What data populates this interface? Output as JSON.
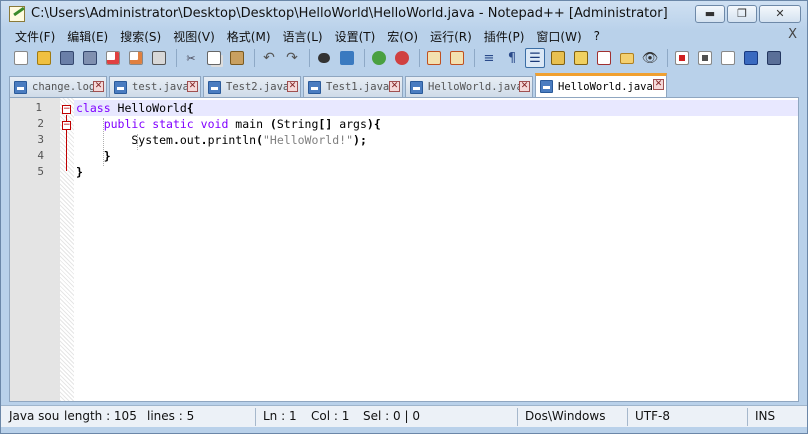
{
  "window": {
    "title": "C:\\Users\\Administrator\\Desktop\\Desktop\\HelloWorld\\HelloWorld.java - Notepad++ [Administrator]",
    "minimize": "▬",
    "restore": "❐",
    "close": "✕"
  },
  "menu": {
    "items": [
      "文件(F)",
      "编辑(E)",
      "搜索(S)",
      "视图(V)",
      "格式(M)",
      "语言(L)",
      "设置(T)",
      "宏(O)",
      "运行(R)",
      "插件(P)",
      "窗口(W)",
      "?"
    ],
    "close": "X"
  },
  "toolbar": {
    "icons": [
      "new-file-icon",
      "open-file-icon",
      "save-icon",
      "save-all-icon",
      "close-icon",
      "close-all-icon",
      "print-icon",
      "cut-icon",
      "copy-icon",
      "paste-icon",
      "undo-icon",
      "redo-icon",
      "find-icon",
      "replace-icon",
      "zoom-in-icon",
      "zoom-out-icon",
      "sync-vertical-icon",
      "sync-horizontal-icon",
      "word-wrap-icon",
      "show-all-chars-icon",
      "indent-guide-icon",
      "user-lang-icon",
      "doc-map-icon",
      "function-list-icon",
      "folder-workspace-icon",
      "monitor-icon",
      "record-macro-icon",
      "stop-macro-icon",
      "play-macro-icon",
      "run-macro-multiple-icon",
      "save-macro-icon"
    ]
  },
  "tabs": [
    {
      "label": "change.log",
      "close": "✕"
    },
    {
      "label": "test.java",
      "close": "✕"
    },
    {
      "label": "Test2.java",
      "close": "✕"
    },
    {
      "label": "Test1.java",
      "close": "✕"
    },
    {
      "label": "HelloWorld.java",
      "close": "✕"
    },
    {
      "label": "HelloWorld.java",
      "close": "✕"
    }
  ],
  "editor": {
    "lines": [
      {
        "num": "1",
        "parts": [
          {
            "t": "class",
            "c": "kw"
          },
          {
            "t": " HelloWorld",
            "c": ""
          },
          {
            "t": "{",
            "c": "op"
          }
        ]
      },
      {
        "num": "2",
        "parts": [
          {
            "t": "    ",
            "c": ""
          },
          {
            "t": "public",
            "c": "kw"
          },
          {
            "t": " ",
            "c": ""
          },
          {
            "t": "static",
            "c": "kw"
          },
          {
            "t": " ",
            "c": ""
          },
          {
            "t": "void",
            "c": "kw"
          },
          {
            "t": " main ",
            "c": ""
          },
          {
            "t": "(",
            "c": "op"
          },
          {
            "t": "String",
            "c": ""
          },
          {
            "t": "[]",
            "c": "op"
          },
          {
            "t": " args",
            "c": ""
          },
          {
            "t": "){",
            "c": "op"
          }
        ]
      },
      {
        "num": "3",
        "parts": [
          {
            "t": "        System",
            "c": ""
          },
          {
            "t": ".",
            "c": "op"
          },
          {
            "t": "out",
            "c": ""
          },
          {
            "t": ".",
            "c": "op"
          },
          {
            "t": "println",
            "c": ""
          },
          {
            "t": "(",
            "c": "op"
          },
          {
            "t": "\"HelloWorld!\"",
            "c": "str"
          },
          {
            "t": ");",
            "c": "op"
          }
        ]
      },
      {
        "num": "4",
        "parts": [
          {
            "t": "    ",
            "c": ""
          },
          {
            "t": "}",
            "c": "op"
          }
        ]
      },
      {
        "num": "5",
        "parts": [
          {
            "t": "}",
            "c": "op"
          }
        ]
      }
    ]
  },
  "status": {
    "lang": "Java sou",
    "length": "length : 105",
    "lines": "lines : 5",
    "ln": "Ln : 1",
    "col": "Col : 1",
    "sel": "Sel : 0 | 0",
    "eol": "Dos\\Windows",
    "encoding": "UTF-8",
    "mode": "INS"
  }
}
